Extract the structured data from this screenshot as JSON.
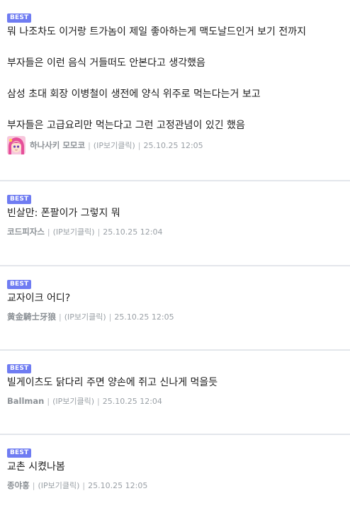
{
  "comments": [
    {
      "badge": "BEST",
      "lines": [
        "뭐 나조차도 이거랑 트가놈이 제일 좋아하는게 맥도날드인거 보기 전까지",
        "부자들은 이런 음식 거들떠도 안본다고 생각했음",
        "삼성 초대 회장 이병철이 생전에 양식 위주로 먹는다는거 보고",
        "부자들은 고급요리만 먹는다고 그런 고정관념이 있긴 했음"
      ],
      "author": "하나사키 모모코",
      "has_avatar": true,
      "avatar_icon": "anime-girl-avatar-icon",
      "ip_label": "(IP보기클릭)",
      "separator": "|",
      "timestamp": "25.10.25 12:05"
    },
    {
      "badge": "BEST",
      "lines": [
        "빈살만: 폰팔이가 그렇지 뭐"
      ],
      "author": "코드피자스",
      "ip_label": "(IP보기클릭)",
      "separator": "|",
      "timestamp": "25.10.25 12:04"
    },
    {
      "badge": "BEST",
      "lines": [
        "교자이크 어디?"
      ],
      "author": "黄金騎士牙狼",
      "ip_label": "(IP보기클릭)",
      "separator": "|",
      "timestamp": "25.10.25 12:05"
    },
    {
      "badge": "BEST",
      "lines": [
        "빌게이츠도 닭다리 주면 양손에 쥐고 신나게 먹을듯"
      ],
      "author": "Ballman",
      "ip_label": "(IP보기클릭)",
      "separator": "|",
      "timestamp": "25.10.25 12:04"
    },
    {
      "badge": "BEST",
      "lines": [
        "교촌 시켰나봄"
      ],
      "author": "종야홍",
      "ip_label": "(IP보기클릭)",
      "separator": "|",
      "timestamp": "25.10.25 12:05"
    }
  ],
  "colors": {
    "badge_bg": "#6f7cf2",
    "badge_text": "#ffffff",
    "divider": "#e3e6eb",
    "meta_text": "#9aa0a6"
  }
}
